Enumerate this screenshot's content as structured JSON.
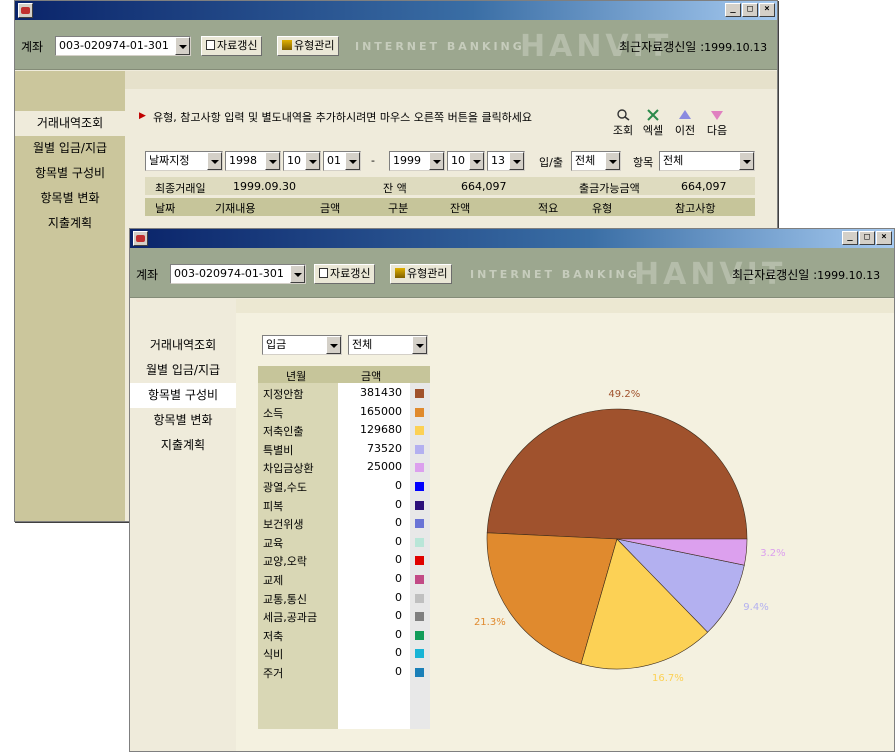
{
  "back_window": {
    "account_label": "계좌",
    "account_value": "003-020974-01-301",
    "refresh_label": "자료갱신",
    "type_manage_label": "유형관리",
    "brand_text": "INTERNET BANKING",
    "brand_big": "HANVIT",
    "update_label": "최근자료갱신일 :",
    "update_date": "1999.10.13",
    "sidebar": [
      "거래내역조회",
      "월별 입금/지급",
      "항목별 구성비",
      "항목별 변화",
      "지출계획"
    ],
    "hint": "유형, 참고사항 입력 및 별도내역을 추가하시려면 마우스 오른쪽 버튼을 클릭하세요",
    "buttons": [
      "조회",
      "엑셀",
      "이전",
      "다음"
    ],
    "date_mode": "날짜지정",
    "from_year": "1998",
    "from_month": "10",
    "from_day": "01",
    "range_sep": "-",
    "to_year": "1999",
    "to_month": "10",
    "to_day": "13",
    "io_label": "입/출",
    "io_value": "전체",
    "item_label": "항목",
    "item_value": "전체",
    "last_date_label": "최종거래일",
    "last_date": "1999.09.30",
    "balance_label": "잔 액",
    "balance": "664,097",
    "available_label": "출금가능금액",
    "available": "664,097",
    "columns": [
      "날짜",
      "기재내용",
      "금액",
      "구분",
      "잔액",
      "적요",
      "유형",
      "참고사항"
    ]
  },
  "front_window": {
    "account_label": "계좌",
    "account_value": "003-020974-01-301",
    "refresh_label": "자료갱신",
    "type_manage_label": "유형관리",
    "brand_text": "INTERNET BANKING",
    "brand_big": "HANVIT",
    "update_label": "최근자료갱신일 :",
    "update_date": "1999.10.13",
    "sidebar": [
      "거래내역조회",
      "월별 입금/지급",
      "항목별 구성비",
      "항목별 변화",
      "지출계획"
    ],
    "type_select": "입금",
    "scope_select": "전체",
    "table_header": {
      "month": "년월",
      "amount": "금액"
    },
    "rows": [
      {
        "name": "지정안함",
        "amount": "381430",
        "color": "#a0522d"
      },
      {
        "name": "소득",
        "amount": "165000",
        "color": "#e08a2e"
      },
      {
        "name": "저축인출",
        "amount": "129680",
        "color": "#fcd155"
      },
      {
        "name": "특별비",
        "amount": "73520",
        "color": "#b3b0f0"
      },
      {
        "name": "차입금상환",
        "amount": "25000",
        "color": "#dca0ee"
      },
      {
        "name": "광열,수도",
        "amount": "0",
        "color": "#0000ff"
      },
      {
        "name": "피복",
        "amount": "0",
        "color": "#2b0f7a"
      },
      {
        "name": "보건위생",
        "amount": "0",
        "color": "#6a74d6"
      },
      {
        "name": "교육",
        "amount": "0",
        "color": "#b9e6d8"
      },
      {
        "name": "교양,오락",
        "amount": "0",
        "color": "#e00000"
      },
      {
        "name": "교제",
        "amount": "0",
        "color": "#c24a86"
      },
      {
        "name": "교통,통신",
        "amount": "0",
        "color": "#c0c0c0"
      },
      {
        "name": "세금,공과금",
        "amount": "0",
        "color": "#808080"
      },
      {
        "name": "저축",
        "amount": "0",
        "color": "#119c5a"
      },
      {
        "name": "식비",
        "amount": "0",
        "color": "#19b4d6"
      },
      {
        "name": "주거",
        "amount": "0",
        "color": "#1a7fb8"
      }
    ]
  },
  "chart_data": {
    "type": "pie",
    "categories": [
      "지정안함",
      "소득",
      "저축인출",
      "특별비",
      "차입금상환"
    ],
    "values": [
      381430,
      165000,
      129680,
      73520,
      25000
    ],
    "labels": [
      "49.2%",
      "21.3%",
      "16.7%",
      "9.4%",
      "3.2%"
    ],
    "colors": [
      "#a0522d",
      "#e08a2e",
      "#fcd155",
      "#b3b0f0",
      "#dca0ee"
    ],
    "title": "",
    "legend": "left"
  }
}
